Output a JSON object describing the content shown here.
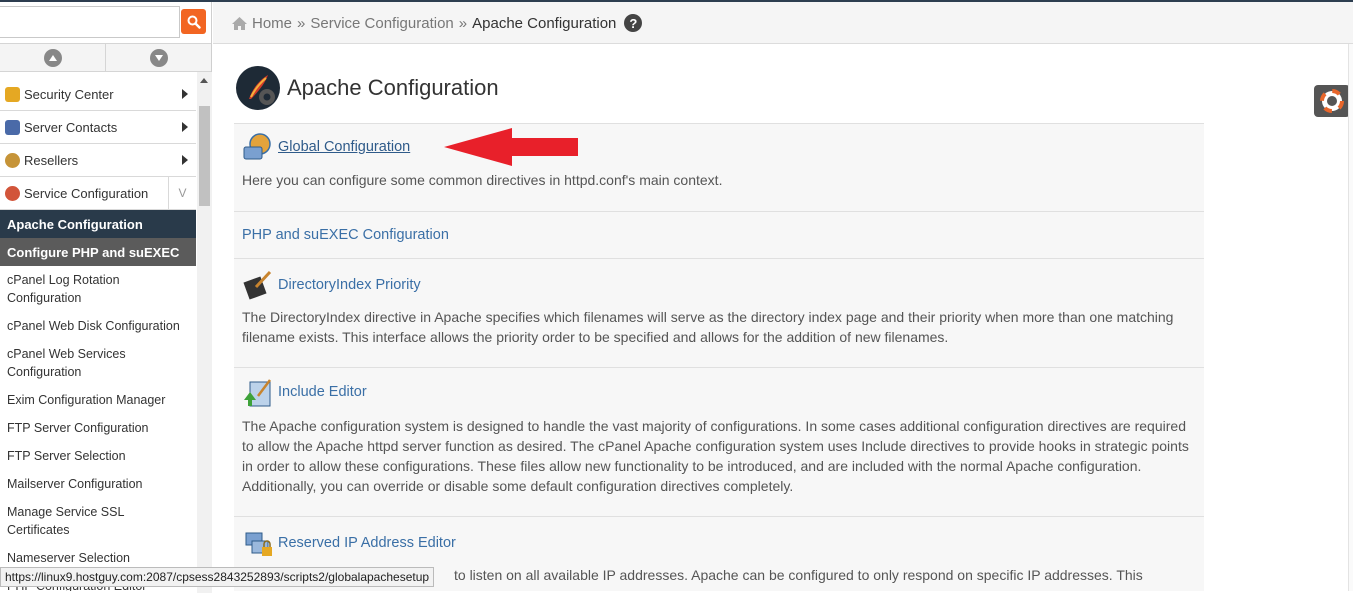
{
  "search": {
    "placeholder": "",
    "value": ""
  },
  "breadcrumb": {
    "home": "Home",
    "sep1": "»",
    "section": "Service Configuration",
    "sep2": "»",
    "current": "Apache Configuration",
    "help": "?"
  },
  "sidebar": {
    "categories": [
      {
        "label": "Security Center"
      },
      {
        "label": "Server Contacts"
      },
      {
        "label": "Resellers"
      },
      {
        "label": "Service Configuration",
        "expander": "V"
      }
    ],
    "subitems": [
      {
        "label": "Apache Configuration",
        "state": "active"
      },
      {
        "label": "Configure PHP and suEXEC",
        "state": "highlight"
      },
      {
        "label": "cPanel Log Rotation Configuration"
      },
      {
        "label": "cPanel Web Disk Configuration"
      },
      {
        "label": "cPanel Web Services Configuration"
      },
      {
        "label": "Exim Configuration Manager"
      },
      {
        "label": "FTP Server Configuration"
      },
      {
        "label": "FTP Server Selection"
      },
      {
        "label": "Mailserver Configuration"
      },
      {
        "label": "Manage Service SSL Certificates"
      },
      {
        "label": "Nameserver Selection"
      },
      {
        "label": "PHP Configuration Editor"
      }
    ]
  },
  "status_url": "https://linux9.hostguy.com:2087/cpsess2843252893/scripts2/globalapachesetup",
  "page": {
    "title": "Apache Configuration",
    "items": [
      {
        "link": "Global Configuration",
        "desc": "Here you can configure some common directives in httpd.conf's main context."
      },
      {
        "link": "PHP and suEXEC Configuration",
        "desc": ""
      },
      {
        "link": "DirectoryIndex Priority",
        "desc": "The DirectoryIndex directive in Apache specifies which filenames will serve as the directory index page and their priority when more than one matching filename exists. This interface allows the priority order to be specified and allows for the addition of new filenames."
      },
      {
        "link": "Include Editor",
        "desc": "The Apache configuration system is designed to handle the vast majority of configurations. In some cases additional configuration directives are required to allow the Apache httpd server function as desired. The cPanel Apache configuration system uses Include directives to provide hooks in strategic points in order to allow these configurations. These files allow new functionality to be introduced, and are included with the normal Apache configuration. Additionally, you can override or disable some default configuration directives completely."
      },
      {
        "link": "Reserved IP Address Editor",
        "desc": "to listen on all available IP addresses. Apache can be configured to only respond on specific IP addresses. This"
      }
    ]
  },
  "colors": {
    "accent": "#f26522",
    "active_bg": "#293a4a",
    "link": "#3a6fa6",
    "arrow": "#e8202a"
  }
}
